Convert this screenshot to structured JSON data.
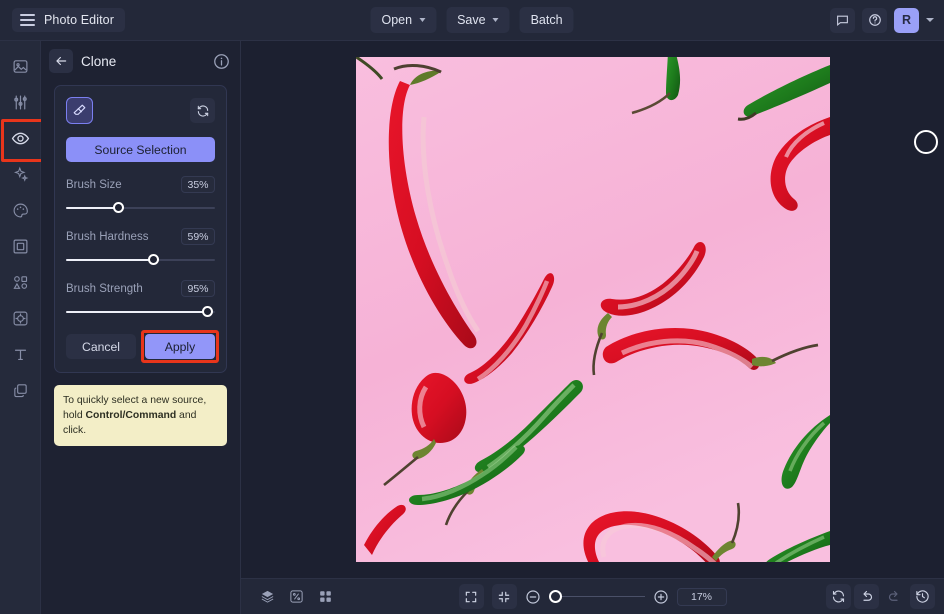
{
  "app": {
    "title": "Photo Editor"
  },
  "topbar": {
    "menu_icon": "hamburger-icon",
    "buttons": [
      {
        "label": "Open",
        "caret": true
      },
      {
        "label": "Save",
        "caret": true
      },
      {
        "label": "Batch",
        "caret": false
      }
    ],
    "right": {
      "feedback_icon": "comment-icon",
      "help_icon": "help-circle-icon",
      "avatar_initial": "R",
      "avatar_color": "#9aa0f7"
    }
  },
  "rail": {
    "items": [
      {
        "name": "sidebar-item-image",
        "icon": "image-icon",
        "active": false
      },
      {
        "name": "sidebar-item-adjust",
        "icon": "sliders-icon",
        "active": false
      },
      {
        "name": "sidebar-item-retouch",
        "icon": "eye-icon",
        "active": true
      },
      {
        "name": "sidebar-item-effects",
        "icon": "sparkles-icon",
        "active": false
      },
      {
        "name": "sidebar-item-color",
        "icon": "palette-icon",
        "active": false
      },
      {
        "name": "sidebar-item-frame",
        "icon": "frame-icon",
        "active": false
      },
      {
        "name": "sidebar-item-shapes",
        "icon": "shapes-icon",
        "active": false
      },
      {
        "name": "sidebar-item-background",
        "icon": "background-icon",
        "active": false
      },
      {
        "name": "sidebar-item-text",
        "icon": "text-icon",
        "active": false
      },
      {
        "name": "sidebar-item-layers",
        "icon": "layers-copy-icon",
        "active": false
      }
    ],
    "highlight_color": "#e8351b"
  },
  "panel": {
    "back_icon": "arrow-left-icon",
    "title": "Clone",
    "info_icon": "info-circle-icon",
    "tool_icon": "eraser-icon",
    "reset_icon": "refresh-icon",
    "source_button": "Source Selection",
    "sliders": [
      {
        "label": "Brush Size",
        "value": "35%",
        "percent": 35
      },
      {
        "label": "Brush Hardness",
        "value": "59%",
        "percent": 59
      },
      {
        "label": "Brush Strength",
        "value": "95%",
        "percent": 95
      }
    ],
    "cancel_label": "Cancel",
    "apply_label": "Apply",
    "apply_highlight_color": "#e8351b",
    "tip_text_1": "To quickly select a new source, hold ",
    "tip_text_bold": "Control/Command",
    "tip_text_2": " and click."
  },
  "canvas": {
    "image_description": "Red and green chili peppers on a pink background",
    "background_color": "#f7b8d8",
    "brush_cursor": "brush-cursor-circle"
  },
  "bottombar": {
    "left_icons": [
      {
        "name": "layers-icon",
        "sunk": false
      },
      {
        "name": "compare-icon",
        "sunk": false
      },
      {
        "name": "grid-icon",
        "sunk": false
      }
    ],
    "center": {
      "fit_icon": "fit-screen-icon",
      "actual_icon": "collapse-icon",
      "zoom_out_icon": "zoom-out-icon",
      "zoom_in_icon": "zoom-in-icon",
      "zoom_value": "17%",
      "zoom_percent": 17
    },
    "right_icons": [
      {
        "name": "reset-icon",
        "sunk": true,
        "dim": false
      },
      {
        "name": "undo-icon",
        "sunk": true,
        "dim": false
      },
      {
        "name": "redo-icon",
        "sunk": false,
        "dim": true
      },
      {
        "name": "history-icon",
        "sunk": true,
        "dim": false
      }
    ]
  }
}
